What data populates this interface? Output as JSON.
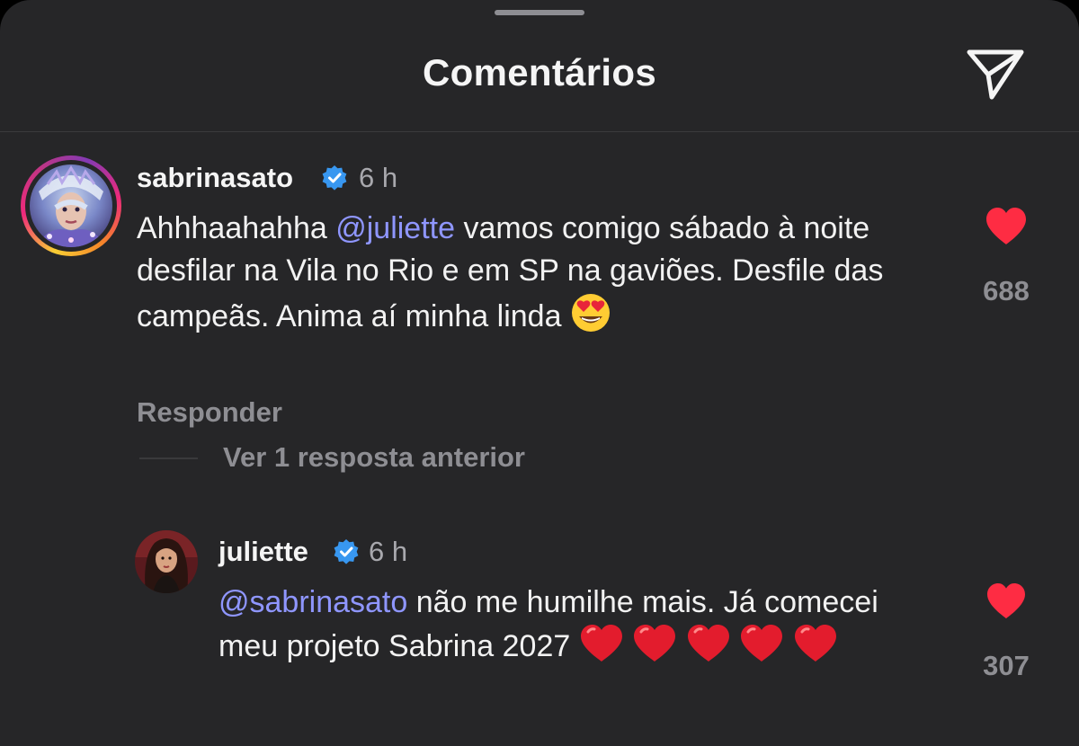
{
  "header": {
    "title": "Comentários",
    "share_icon": "paper-plane-icon"
  },
  "comments": [
    {
      "username": "sabrinasato",
      "verified": true,
      "time": "6 h",
      "text_pre": "Ahhhaahahha ",
      "mention": "@juliette",
      "text_post": " vamos comigo sábado à noite desfilar na Vila no Rio e em SP na gaviões. Desfile das campeãs. Anima aí minha linda",
      "emoji": "heart-eyes-emoji",
      "likes": "688",
      "reply_label": "Responder",
      "view_replies_label": "Ver 1 resposta anterior"
    },
    {
      "username": "juliette",
      "verified": true,
      "time": "6 h",
      "mention": "@sabrinasato",
      "text_post": " não me humilhe mais. Já comecei meu projeto Sabrina 2027",
      "emoji": "red-heart-emoji",
      "likes": "307"
    }
  ],
  "colors": {
    "background": "#262628",
    "mention": "#8f96ff",
    "like": "#fe2c43",
    "verified": "#3897f0",
    "secondary_text": "#8e8e93"
  }
}
